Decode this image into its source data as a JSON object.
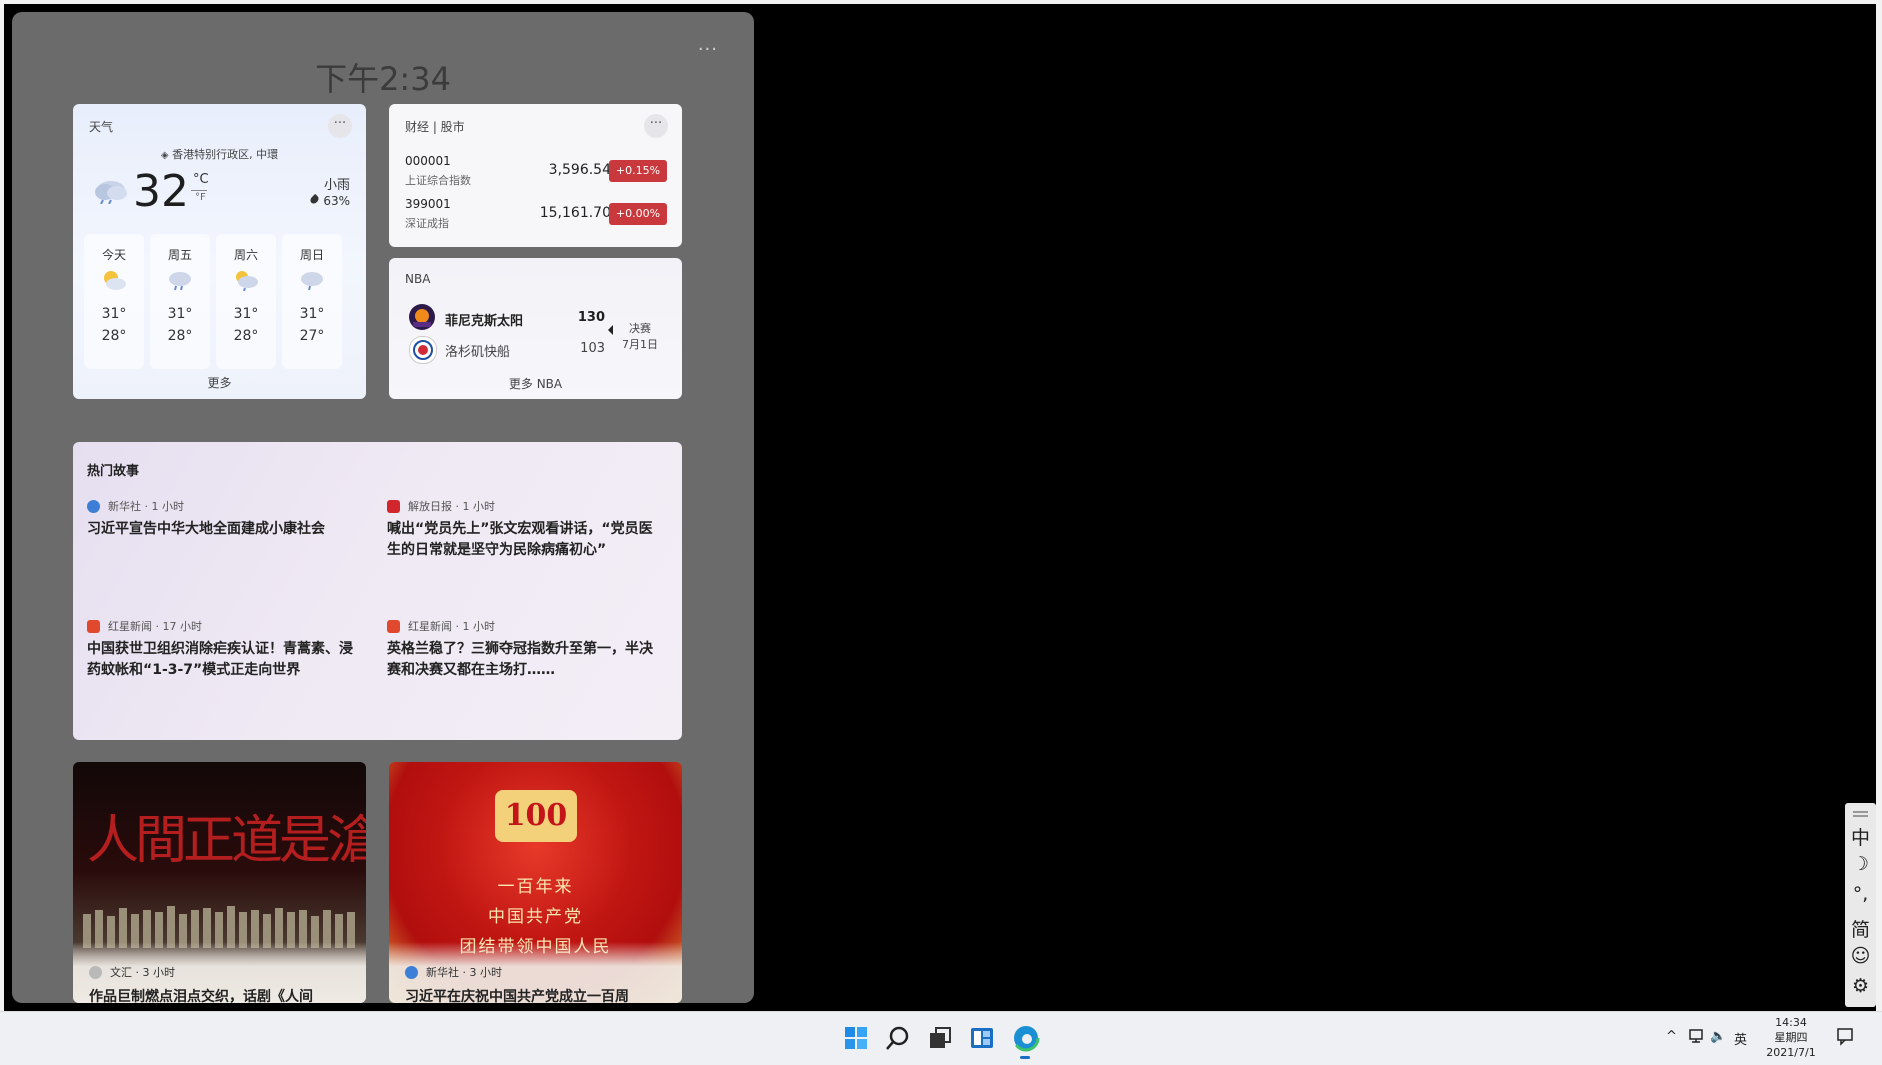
{
  "panel": {
    "time": "下午2:34",
    "more": "..."
  },
  "weather": {
    "title": "天气",
    "location": "香港特别行政区, 中環",
    "temp": "32",
    "unit_c": "°C",
    "unit_f": "°F",
    "condition": "小雨",
    "humidity": "63%",
    "forecast": [
      {
        "day": "今天",
        "high": "31°",
        "low": "28°",
        "icon": "partly-sunny-icon"
      },
      {
        "day": "周五",
        "high": "31°",
        "low": "28°",
        "icon": "rain-cloud-icon"
      },
      {
        "day": "周六",
        "high": "31°",
        "low": "28°",
        "icon": "sun-rain-icon"
      },
      {
        "day": "周日",
        "high": "31°",
        "low": "27°",
        "icon": "rain-cloud-icon"
      }
    ],
    "more": "更多"
  },
  "finance": {
    "title": "财经 | 股市",
    "stocks": [
      {
        "code": "000001",
        "name": "上证综合指数",
        "value": "3,596.54",
        "change": "+0.15%"
      },
      {
        "code": "399001",
        "name": "深证成指",
        "value": "15,161.70",
        "change": "+0.00%"
      }
    ],
    "badge_color": "#c8383c"
  },
  "nba": {
    "title": "NBA",
    "teams": [
      {
        "name": "菲尼克斯太阳",
        "score": "130",
        "winner": true
      },
      {
        "name": "洛杉矶快船",
        "score": "103",
        "winner": false
      }
    ],
    "stage": "决赛",
    "date": "7月1日",
    "more": "更多 NBA"
  },
  "stories": {
    "title": "热门故事",
    "items": [
      {
        "source": "新华社 · 1 小时",
        "title": "习近平宣告中华大地全面建成小康社会"
      },
      {
        "source": "解放日报 · 1 小时",
        "title": "喊出“党员先上”张文宏观看讲话，“党员医生的日常就是坚守为民除病痛初心”"
      },
      {
        "source": "红星新闻 · 17 小时",
        "title": "中国获世卫组织消除疟疾认证！青蒿素、浸药蚊帐和“1-3-7”模式正走向世界"
      },
      {
        "source": "红星新闻 · 1 小时",
        "title": "英格兰稳了？三狮夺冠指数升至第一，半决赛和决赛又都在主场打……"
      }
    ]
  },
  "image_cards": [
    {
      "image_text": "人間正道是滄桑",
      "source": "文汇 · 3 小时",
      "title": "作品巨制燃点泪点交织，话剧《人间"
    },
    {
      "image_text_top": "100",
      "image_lines": [
        "一百年来",
        "中国共产党",
        "团结带领中国人民"
      ],
      "source": "新华社 · 3 小时",
      "title": "习近平在庆祝中国共产党成立一百周"
    }
  ],
  "ime": {
    "mode": "中",
    "half_width": "☽",
    "punct": "°,",
    "script": "简",
    "emoji": "☺",
    "settings": "⚙"
  },
  "taskbar": {
    "tray_lang": "英",
    "clock_time": "14:34",
    "clock_day": "星期四",
    "clock_date": "2021/7/1"
  }
}
